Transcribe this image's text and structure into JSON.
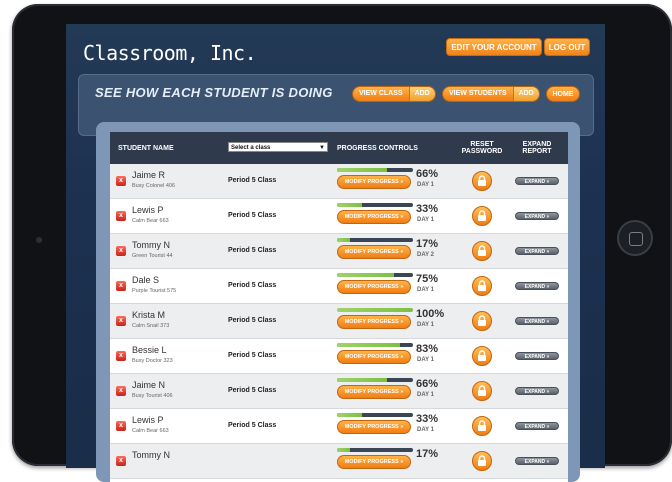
{
  "app": {
    "title": "Classroom, Inc."
  },
  "header": {
    "edit_account": "EDIT YOUR ACCOUNT",
    "logout": "LOG OUT"
  },
  "subheader": {
    "heading": "SEE HOW EACH STUDENT IS DOING",
    "view_class": "VIEW CLASS",
    "add_class": "ADD",
    "view_students": "VIEW STUDENTS",
    "add_students": "ADD",
    "home": "HOME"
  },
  "table": {
    "col_student": "STUDENT NAME",
    "select_class": {
      "value": "Select a class"
    },
    "col_progress": "PROGRESS CONTROLS",
    "col_reset": "RESET PASSWORD",
    "col_expand": "EXPAND REPORT",
    "modify_label": "MODIFY PROGRESS »",
    "expand_label": "EXPAND »",
    "delete_icon": "x-icon",
    "rows": [
      {
        "name": "Jaime R",
        "nickname": "Busy Colonel 406",
        "class": "Period 5 Class",
        "progress_pct": "66%",
        "progress": 0.66,
        "day": "DAY 1"
      },
      {
        "name": "Lewis P",
        "nickname": "Calm Bear 663",
        "class": "Period 5 Class",
        "progress_pct": "33%",
        "progress": 0.33,
        "day": "DAY 1"
      },
      {
        "name": "Tommy N",
        "nickname": "Green Tourist 44",
        "class": "Period 5 Class",
        "progress_pct": "17%",
        "progress": 0.17,
        "day": "DAY 2"
      },
      {
        "name": "Dale S",
        "nickname": "Purple Tourist 575",
        "class": "Period 5 Class",
        "progress_pct": "75%",
        "progress": 0.75,
        "day": "DAY 1"
      },
      {
        "name": "Krista M",
        "nickname": "Calm Snail 373",
        "class": "Period 5 Class",
        "progress_pct": "100%",
        "progress": 1.0,
        "day": "DAY 1"
      },
      {
        "name": "Bessie L",
        "nickname": "Busy Doctor 323",
        "class": "Period 5 Class",
        "progress_pct": "83%",
        "progress": 0.83,
        "day": "DAY 1"
      },
      {
        "name": "Jaime N",
        "nickname": "Busy Tourist 406",
        "class": "Period 5 Class",
        "progress_pct": "66%",
        "progress": 0.66,
        "day": "DAY 1"
      },
      {
        "name": "Lewis P",
        "nickname": "Calm Bear 663",
        "class": "Period 5 Class",
        "progress_pct": "33%",
        "progress": 0.33,
        "day": "DAY 1"
      },
      {
        "name": "Tommy N",
        "nickname": "",
        "class": "",
        "progress_pct": "17%",
        "progress": 0.17,
        "day": ""
      }
    ]
  },
  "colors": {
    "accent_orange": "#f0821a",
    "header_dark": "#2f3b4c",
    "progress_green": "#7cc043"
  }
}
